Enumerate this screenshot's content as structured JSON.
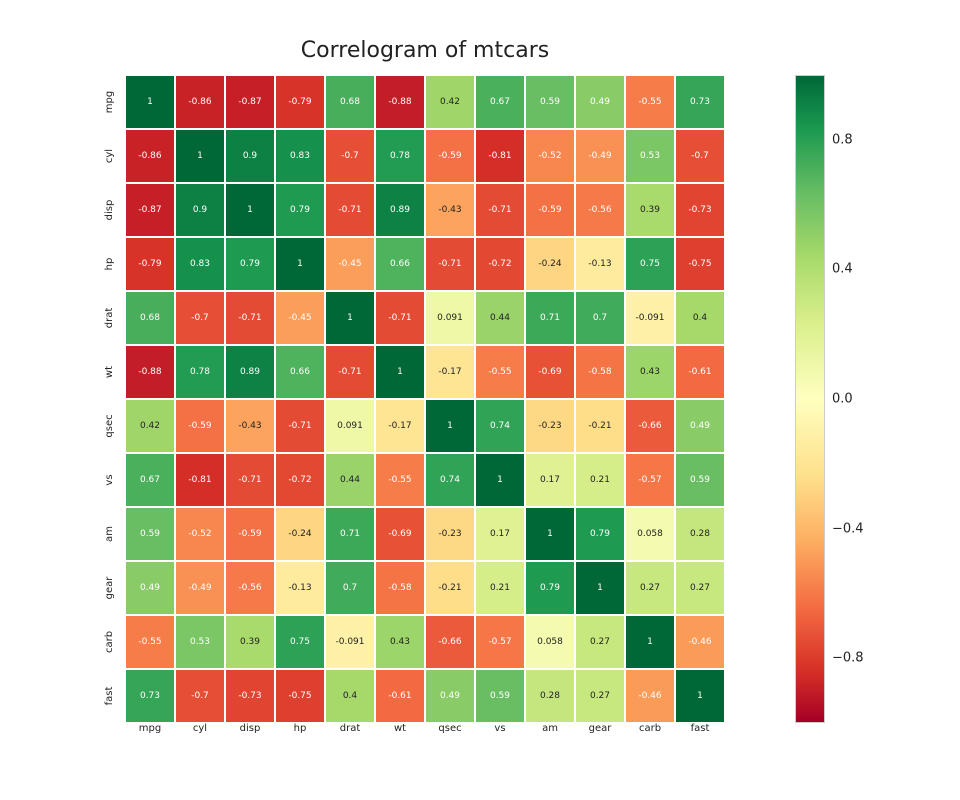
{
  "chart_data": {
    "type": "heatmap",
    "title": "Correlogram of mtcars",
    "labels": [
      "mpg",
      "cyl",
      "disp",
      "hp",
      "drat",
      "wt",
      "qsec",
      "vs",
      "am",
      "gear",
      "carb",
      "fast"
    ],
    "matrix": [
      [
        1,
        -0.86,
        -0.87,
        -0.79,
        0.68,
        -0.88,
        0.42,
        0.67,
        0.59,
        0.49,
        -0.55,
        0.73
      ],
      [
        -0.86,
        1,
        0.9,
        0.83,
        -0.7,
        0.78,
        -0.59,
        -0.81,
        -0.52,
        -0.49,
        0.53,
        -0.7
      ],
      [
        -0.87,
        0.9,
        1,
        0.79,
        -0.71,
        0.89,
        -0.43,
        -0.71,
        -0.59,
        -0.56,
        0.39,
        -0.73
      ],
      [
        -0.79,
        0.83,
        0.79,
        1,
        -0.45,
        0.66,
        -0.71,
        -0.72,
        -0.24,
        -0.13,
        0.75,
        -0.75
      ],
      [
        0.68,
        -0.7,
        -0.71,
        -0.45,
        1,
        -0.71,
        0.091,
        0.44,
        0.71,
        0.7,
        -0.091,
        0.4
      ],
      [
        -0.88,
        0.78,
        0.89,
        0.66,
        -0.71,
        1,
        -0.17,
        -0.55,
        -0.69,
        -0.58,
        0.43,
        -0.61
      ],
      [
        0.42,
        -0.59,
        -0.43,
        -0.71,
        0.091,
        -0.17,
        1,
        0.74,
        -0.23,
        -0.21,
        -0.66,
        0.49
      ],
      [
        0.67,
        -0.81,
        -0.71,
        -0.72,
        0.44,
        -0.55,
        0.74,
        1,
        0.17,
        0.21,
        -0.57,
        0.59
      ],
      [
        0.59,
        -0.52,
        -0.59,
        -0.24,
        0.71,
        -0.69,
        -0.23,
        0.17,
        1,
        0.79,
        0.058,
        0.28
      ],
      [
        0.49,
        -0.49,
        -0.56,
        -0.13,
        0.7,
        -0.58,
        -0.21,
        0.21,
        0.79,
        1,
        0.27,
        0.27
      ],
      [
        -0.55,
        0.53,
        0.39,
        0.75,
        -0.091,
        0.43,
        -0.66,
        -0.57,
        0.058,
        0.27,
        1,
        -0.46
      ],
      [
        0.73,
        -0.7,
        -0.73,
        -0.75,
        0.4,
        -0.61,
        0.49,
        0.59,
        0.28,
        0.27,
        -0.46,
        1
      ]
    ],
    "cmap": "RdYlGn",
    "colorbar_ticks": [
      0.8,
      0.4,
      0.0,
      -0.4,
      -0.8
    ],
    "value_range": [
      -1,
      1
    ]
  }
}
